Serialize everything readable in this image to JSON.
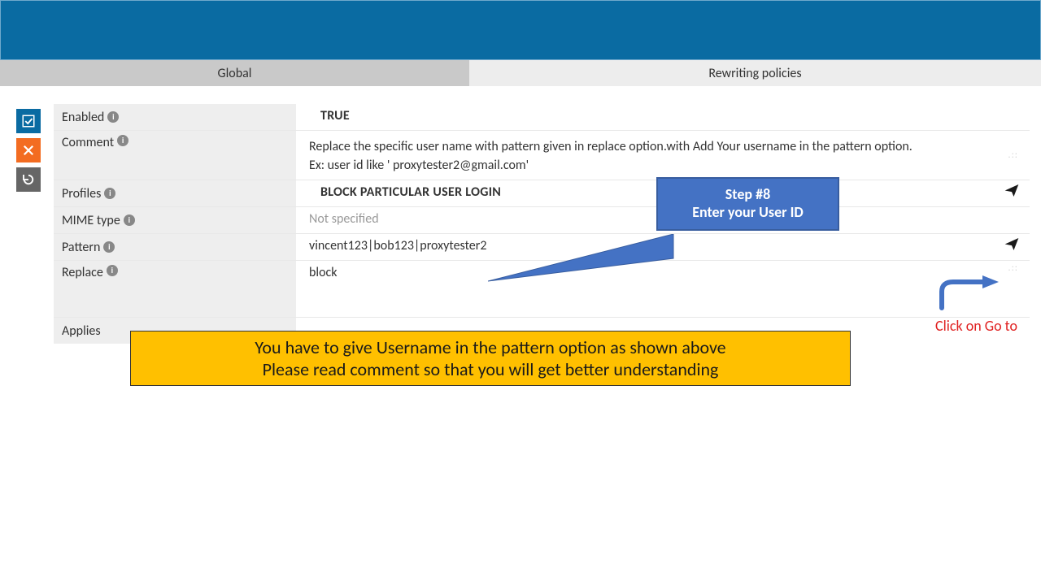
{
  "tabs": {
    "global": "Global",
    "policies": "Rewriting policies"
  },
  "rows": {
    "enabled": {
      "label": "Enabled",
      "value": "TRUE"
    },
    "comment": {
      "label": "Comment",
      "line1": "Replace the specific user name with pattern given in replace option.with Add Your username in the pattern option.",
      "line2": "Ex: user id like ' proxytester2@gmail.com'"
    },
    "profiles": {
      "label": "Profiles",
      "value": "BLOCK PARTICULAR USER LOGIN"
    },
    "mime": {
      "label": "MIME type",
      "value": "Not specified"
    },
    "pattern": {
      "label": "Pattern",
      "value": "vincent123|bob123|proxytester2"
    },
    "replace": {
      "label": "Replace",
      "value": "block"
    },
    "applies": {
      "label": "Applies"
    }
  },
  "callout": {
    "line1": "Step #8",
    "line2": "Enter your User ID"
  },
  "note": {
    "line1": "You have to give Username in the pattern option as shown above",
    "line2": "Please read comment so that you will get better understanding"
  },
  "goto_hint": "Click on Go to"
}
